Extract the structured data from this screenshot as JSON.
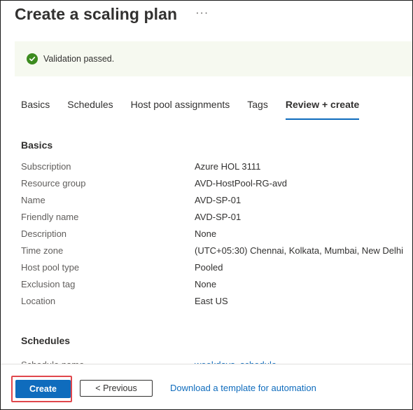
{
  "header": {
    "title": "Create a scaling plan",
    "more_label": "···"
  },
  "banner": {
    "message": "Validation passed.",
    "status_color": "#3c8b1f"
  },
  "tabs": [
    {
      "label": "Basics",
      "active": false
    },
    {
      "label": "Schedules",
      "active": false
    },
    {
      "label": "Host pool assignments",
      "active": false
    },
    {
      "label": "Tags",
      "active": false
    },
    {
      "label": "Review + create",
      "active": true
    }
  ],
  "basics": {
    "heading": "Basics",
    "rows": [
      {
        "label": "Subscription",
        "value": "Azure HOL 3111"
      },
      {
        "label": "Resource group",
        "value": "AVD-HostPool-RG-avd"
      },
      {
        "label": "Name",
        "value": "AVD-SP-01"
      },
      {
        "label": "Friendly name",
        "value": "AVD-SP-01"
      },
      {
        "label": "Description",
        "value": "None"
      },
      {
        "label": "Time zone",
        "value": "(UTC+05:30) Chennai, Kolkata, Mumbai, New Delhi"
      },
      {
        "label": "Host pool type",
        "value": "Pooled"
      },
      {
        "label": "Exclusion tag",
        "value": "None"
      },
      {
        "label": "Location",
        "value": "East US"
      }
    ]
  },
  "schedules": {
    "heading": "Schedules",
    "rows": [
      {
        "label": "Schedule name",
        "value": "weekdays_schedule"
      }
    ]
  },
  "footer": {
    "create_label": "Create",
    "previous_label": "< Previous",
    "download_link": "Download a template for automation"
  },
  "colors": {
    "accent": "#0f6cbd",
    "highlight_outline": "#e0474c",
    "banner_bg": "#f6f9f0"
  }
}
